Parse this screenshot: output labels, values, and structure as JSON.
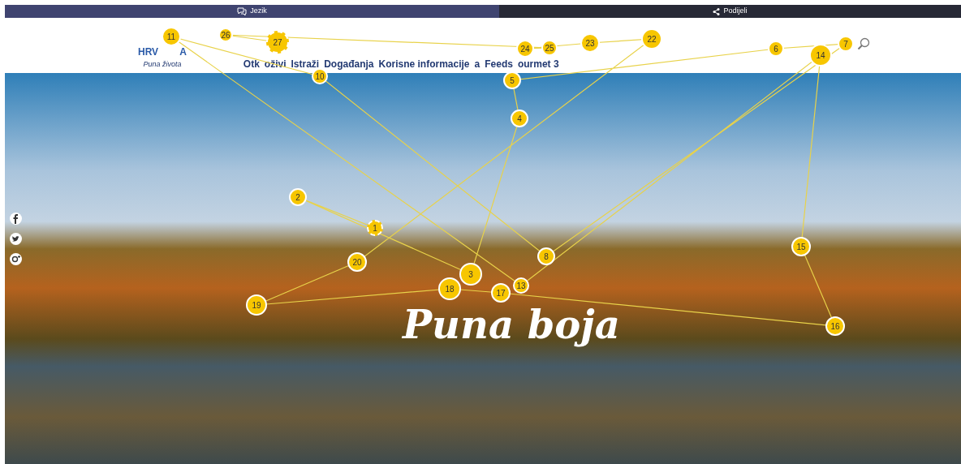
{
  "top_bar": {
    "language": "Jezik",
    "share": "Podijeli"
  },
  "logo": {
    "wordmark_left": "HRV",
    "wordmark_right": "A",
    "tagline": "Puna života"
  },
  "nav": [
    {
      "label": "Otk"
    },
    {
      "label": "oživi"
    },
    {
      "label": "Istraži"
    },
    {
      "label": "Događanja"
    },
    {
      "label": "Korisne informacije"
    },
    {
      "label": "a"
    },
    {
      "label": "Feeds"
    },
    {
      "label": "ourmet 3"
    }
  ],
  "hero": {
    "headline": "Puna boja"
  },
  "social": [
    {
      "kind": "facebook"
    },
    {
      "kind": "twitter"
    },
    {
      "kind": "googleplus"
    }
  ],
  "gaze_points": [
    {
      "label": "1",
      "dashed": true
    },
    {
      "label": "2",
      "dashed": false
    },
    {
      "label": "3",
      "dashed": false
    },
    {
      "label": "4",
      "dashed": false
    },
    {
      "label": "5",
      "dashed": false
    },
    {
      "label": "6",
      "dashed": false
    },
    {
      "label": "7",
      "dashed": false
    },
    {
      "label": "8",
      "dashed": false
    },
    {
      "label": "10",
      "dashed": false
    },
    {
      "label": "11",
      "dashed": false
    },
    {
      "label": "13",
      "dashed": false
    },
    {
      "label": "14",
      "dashed": false
    },
    {
      "label": "15",
      "dashed": false
    },
    {
      "label": "16",
      "dashed": false
    },
    {
      "label": "17",
      "dashed": false
    },
    {
      "label": "18",
      "dashed": false
    },
    {
      "label": "19",
      "dashed": false
    },
    {
      "label": "20",
      "dashed": false
    },
    {
      "label": "22",
      "dashed": false
    },
    {
      "label": "23",
      "dashed": false
    },
    {
      "label": "24",
      "dashed": false
    },
    {
      "label": "25",
      "dashed": false
    },
    {
      "label": "26",
      "dashed": false
    },
    {
      "label": "27",
      "dashed": true
    }
  ]
}
